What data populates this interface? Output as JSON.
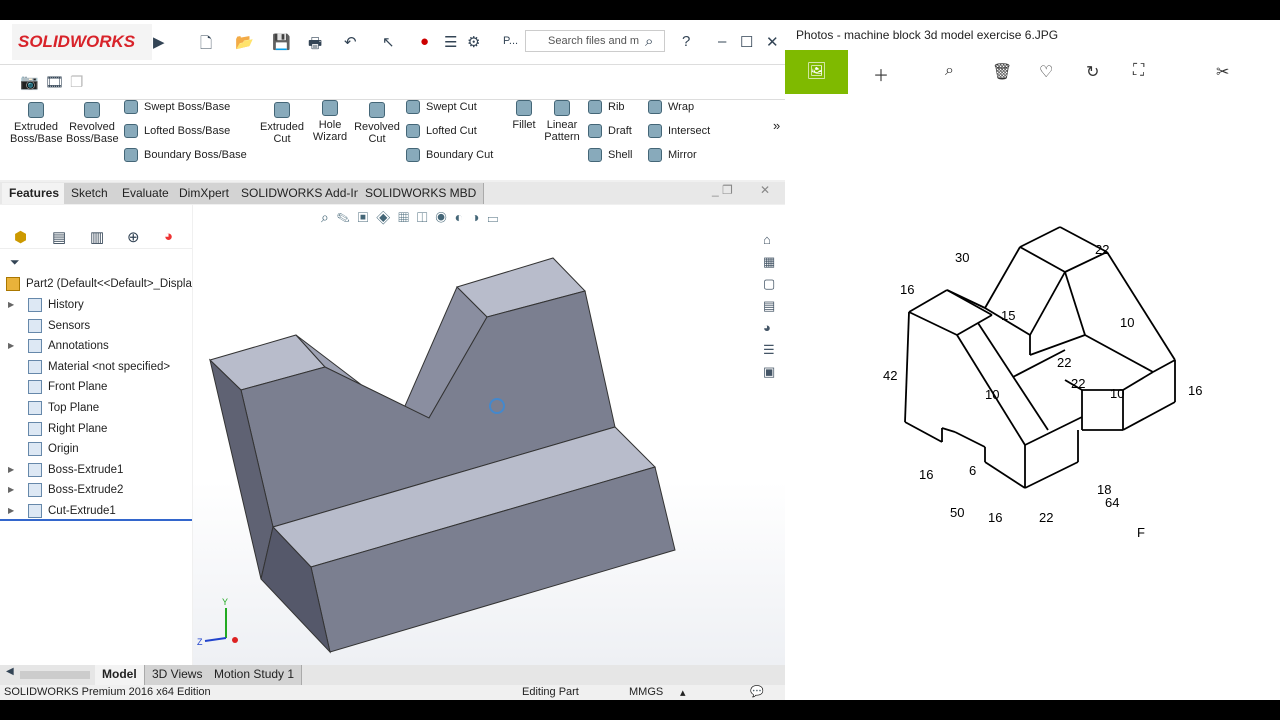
{
  "solidworks": {
    "logo": "SOLIDWORKS",
    "search_placeholder": "Search files and m",
    "p_label": "P...",
    "help": "?",
    "ribbon": {
      "extruded_boss": "Extruded Boss/Base",
      "revolved_boss": "Revolved Boss/Base",
      "swept_boss": "Swept Boss/Base",
      "lofted_boss": "Lofted Boss/Base",
      "boundary_boss": "Boundary Boss/Base",
      "extruded_cut": "Extruded Cut",
      "hole_wizard": "Hole Wizard",
      "revolved_cut": "Revolved Cut",
      "swept_cut": "Swept Cut",
      "lofted_cut": "Lofted Cut",
      "boundary_cut": "Boundary Cut",
      "fillet": "Fillet",
      "linear_pattern": "Linear Pattern",
      "rib": "Rib",
      "draft": "Draft",
      "shell": "Shell",
      "wrap": "Wrap",
      "intersect": "Intersect",
      "mirror": "Mirror",
      "more": "»"
    },
    "tabs": [
      "Features",
      "Sketch",
      "Evaluate",
      "DimXpert",
      "SOLIDWORKS Add-Ins",
      "SOLIDWORKS MBD"
    ],
    "active_tab": "Features",
    "tree": {
      "root": "Part2  (Default<<Default>_Displa",
      "items": [
        "History",
        "Sensors",
        "Annotations",
        "Material <not specified>",
        "Front Plane",
        "Top Plane",
        "Right Plane",
        "Origin",
        "Boss-Extrude1",
        "Boss-Extrude2",
        "Cut-Extrude1"
      ]
    },
    "bottom_tabs": [
      "Model",
      "3D Views",
      "Motion Study 1"
    ],
    "active_bottom_tab": "Model",
    "status": {
      "edition": "SOLIDWORKS Premium 2016 x64 Edition",
      "mode": "Editing Part",
      "units": "MMGS"
    },
    "triad": {
      "x": "Z",
      "y": "Y"
    },
    "colors": {
      "model_face": "#7b7f90",
      "model_top": "#b8bccb",
      "brand": "#d8232a"
    }
  },
  "photos": {
    "title": "Photos - machine block 3d model exercise 6.JPG",
    "accent": "#7fba00",
    "drawing_dimensions": [
      "22",
      "30",
      "16",
      "15",
      "10",
      "42",
      "22",
      "10",
      "22",
      "10",
      "16",
      "16",
      "6",
      "18",
      "50",
      "16",
      "22",
      "64",
      "F"
    ]
  }
}
